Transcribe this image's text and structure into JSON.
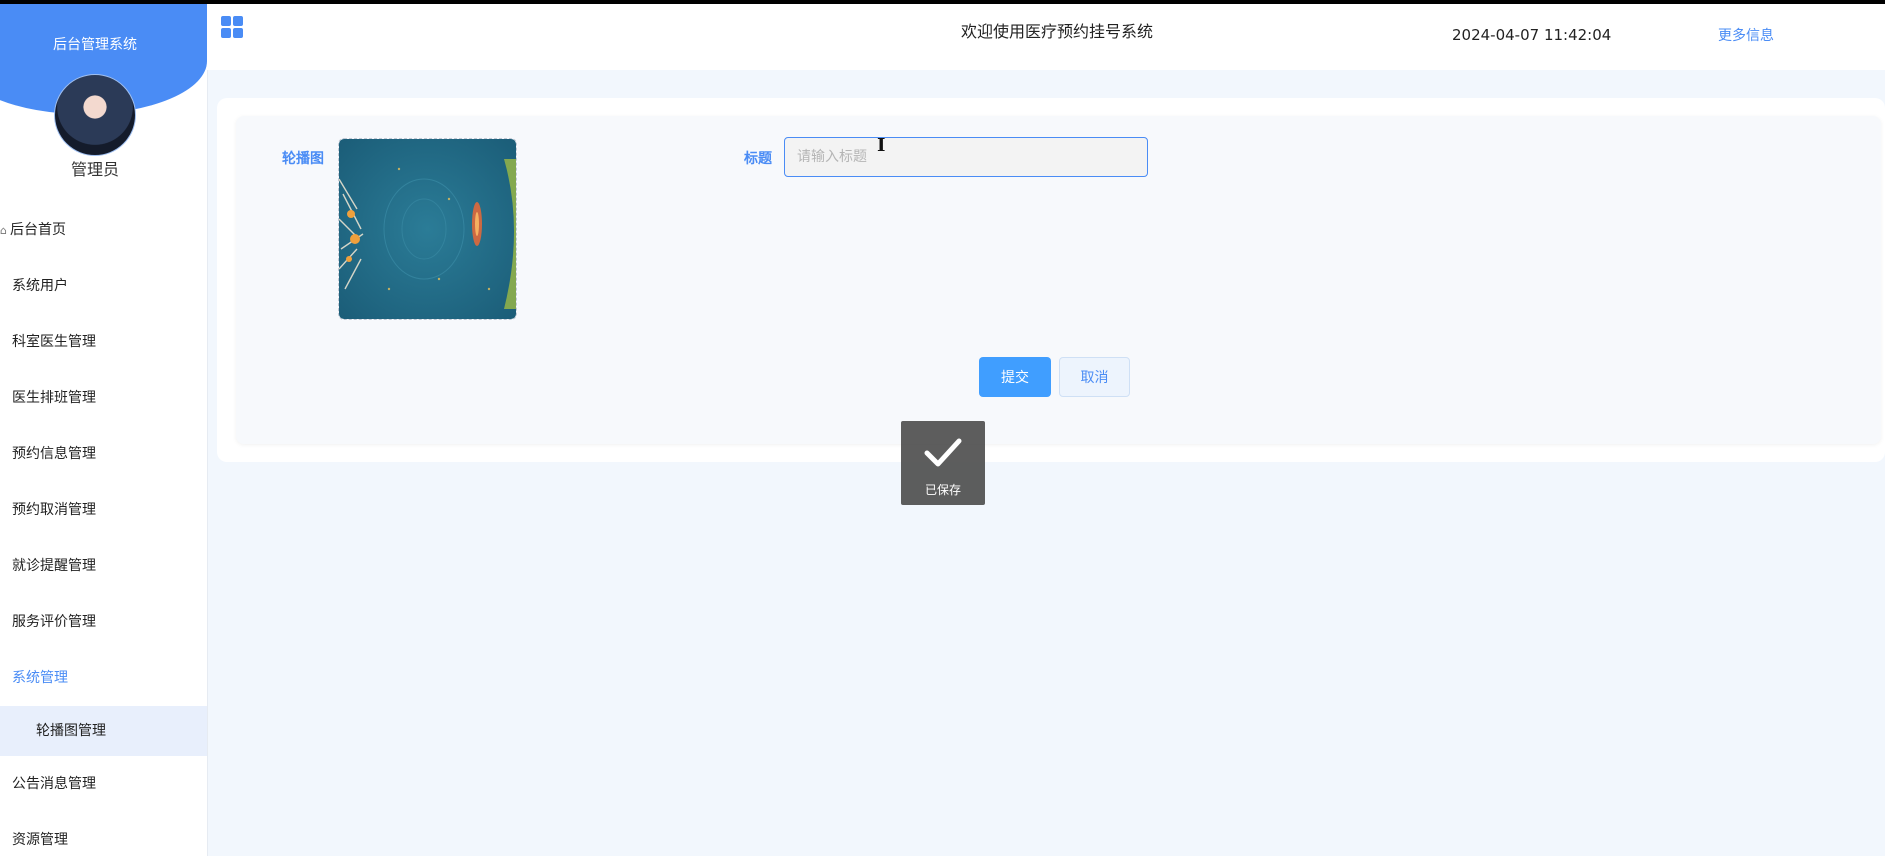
{
  "sidebar": {
    "title": "后台管理系统",
    "role": "管理员",
    "items": [
      {
        "label": "后台首页"
      },
      {
        "label": "系统用户"
      },
      {
        "label": "科室医生管理"
      },
      {
        "label": "医生排班管理"
      },
      {
        "label": "预约信息管理"
      },
      {
        "label": "预约取消管理"
      },
      {
        "label": "就诊提醒管理"
      },
      {
        "label": "服务评价管理"
      },
      {
        "label": "系统管理"
      },
      {
        "label": "轮播图管理"
      },
      {
        "label": "公告消息管理"
      },
      {
        "label": "资源管理"
      }
    ]
  },
  "header": {
    "welcome": "欢迎使用医疗预约挂号系统",
    "datetime": "2024-04-07 11:42:04",
    "more_info": "更多信息"
  },
  "form": {
    "carousel_label": "轮播图",
    "title_label": "标题",
    "title_value": "",
    "title_placeholder": "请输入标题",
    "submit_label": "提交",
    "cancel_label": "取消"
  },
  "toast": {
    "message": "已保存"
  },
  "icons": {
    "menu": "grid-icon",
    "home": "home-icon",
    "toast": "checkmark-icon",
    "cursor": "text-cursor-icon"
  },
  "colors": {
    "accent": "#4a8cf5",
    "primary_button": "#409eff",
    "page_bg": "#f2f7fd",
    "toast_bg": "#4b4b4b"
  }
}
